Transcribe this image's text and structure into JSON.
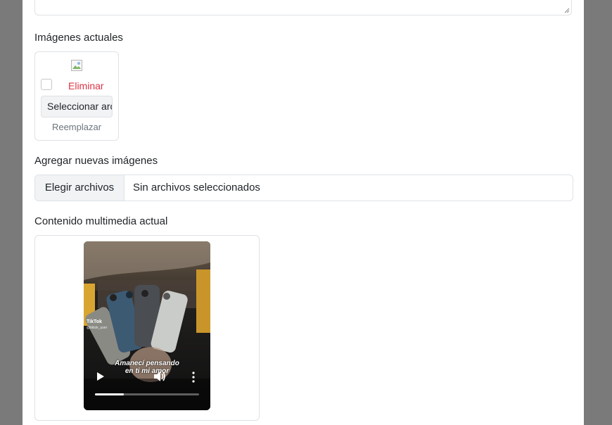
{
  "current_images": {
    "label": "Imágenes actuales",
    "delete_label": "Eliminar",
    "file_button_text": "Seleccionar archivo",
    "replace_label": "Reemplazar",
    "broken_image_icon": "broken-image-icon"
  },
  "new_images": {
    "label": "Agregar nuevas imágenes",
    "choose_button": "Elegir archivos",
    "status": "Sin archivos seleccionados"
  },
  "media": {
    "label": "Contenido multimedia actual",
    "video": {
      "tiktok_logo": "TikTok",
      "tiktok_user": "@tiktok_user",
      "caption_line1": "Amanecí pensando",
      "caption_line2": "en ti mi amor",
      "progress": 0.28,
      "icons": [
        "play-icon",
        "volume-icon",
        "more-options-icon"
      ]
    }
  },
  "colors": {
    "overlay": "#7a7a7a",
    "danger": "#dc3545",
    "muted": "#6c757d",
    "border": "#dee2e6"
  }
}
